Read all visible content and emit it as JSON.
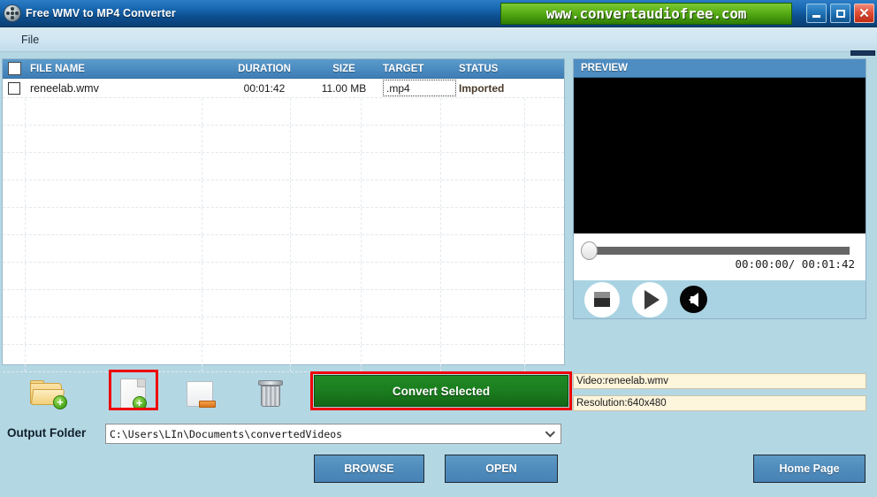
{
  "window": {
    "title": "Free WMV to MP4 Converter",
    "app_icon": "film-reel-icon",
    "url_banner": "www.convertaudiofree.com",
    "controls": {
      "minimize": "minimize-icon",
      "maximize": "maximize-icon",
      "close": "close-icon"
    }
  },
  "menubar": {
    "items": [
      {
        "label": "File"
      }
    ]
  },
  "filelist": {
    "columns": [
      "FILE NAME",
      "DURATION",
      "SIZE",
      "TARGET",
      "STATUS"
    ],
    "rows": [
      {
        "checked": false,
        "name": "reneelab.wmv",
        "duration": "00:01:42",
        "size": "11.00 MB",
        "target": ".mp4",
        "status": "Imported"
      }
    ]
  },
  "preview": {
    "header": "PREVIEW",
    "time_current": "00:00:00",
    "time_separator": "/",
    "time_total": "00:01:42",
    "time_display": "00:00:00/ 00:01:42",
    "slider_position_percent": 0,
    "controls": {
      "stop": "stop-icon",
      "play": "play-icon",
      "volume": "speaker-icon"
    },
    "info": {
      "video": "Video:reneelab.wmv",
      "resolution": "Resolution:640x480"
    }
  },
  "toolbar": {
    "open_folder": "add-folder-icon",
    "add_file": "add-file-icon",
    "remove_file": "remove-file-icon",
    "clear_list": "trash-icon",
    "convert_label": "Convert Selected",
    "highlight_color": "#ee0000"
  },
  "output": {
    "label": "Output Folder",
    "path": "C:\\Users\\LIn\\Documents\\convertedVideos",
    "dropdown_icon": "chevron-down-icon"
  },
  "footer": {
    "browse": "BROWSE",
    "open": "OPEN",
    "home_page": "Home Page"
  },
  "colors": {
    "titlebar": "#0d4f8f",
    "banner_green": "#58ad16",
    "convert_green": "#1b7d1f",
    "highlight_red": "#ee0000",
    "body_blue": "#b4d7e4",
    "header_blue": "#4a8bc0",
    "info_cream": "#fdf5dc"
  }
}
